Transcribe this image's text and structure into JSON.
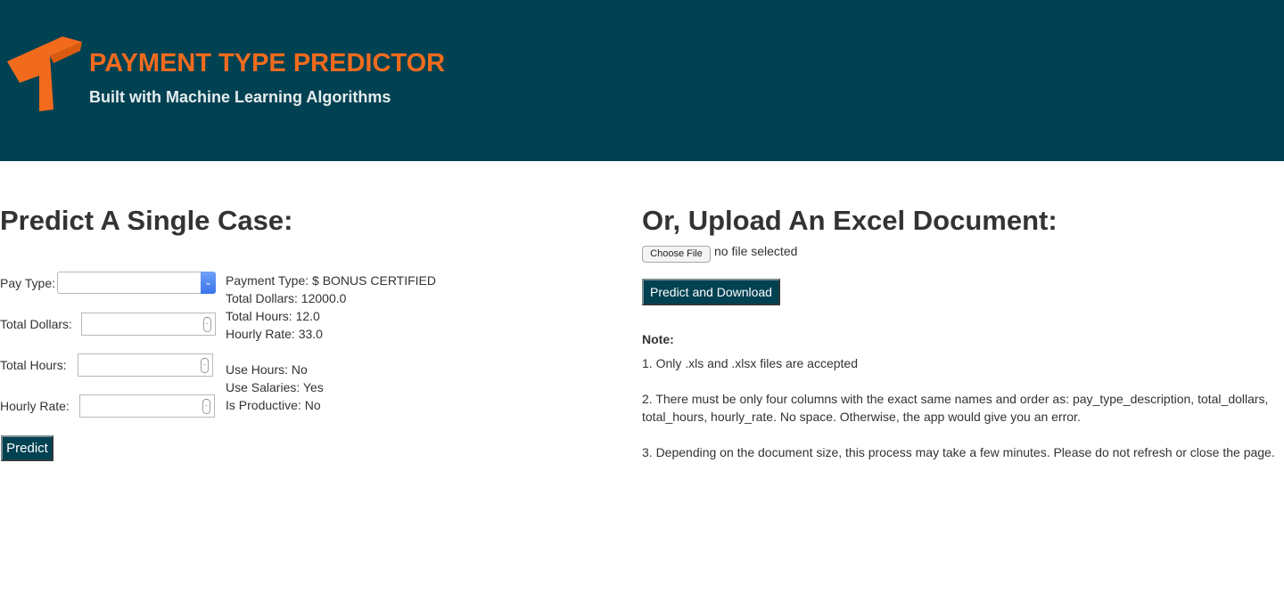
{
  "header": {
    "title": "PAYMENT TYPE PREDICTOR",
    "subtitle": "Built with Machine Learning Algorithms",
    "logo_icon": "orange-t-logo-icon",
    "background_color": "#004152",
    "accent_color": "#f26b1d"
  },
  "single_case": {
    "title": "Predict A Single Case:",
    "fields": {
      "pay_type_label": "Pay Type:",
      "pay_type_value": "",
      "total_dollars_label": "Total Dollars:",
      "total_dollars_value": "",
      "total_hours_label": "Total Hours:",
      "total_hours_value": "",
      "hourly_rate_label": "Hourly Rate:",
      "hourly_rate_value": ""
    },
    "result": {
      "payment_type": "Payment Type: $ BONUS CERTIFIED",
      "total_dollars": "Total Dollars: 12000.0",
      "total_hours": "Total Hours: 12.0",
      "hourly_rate": "Hourly Rate: 33.0",
      "use_hours": "Use Hours: No",
      "use_salaries": "Use Salaries: Yes",
      "is_productive": "Is Productive: No"
    },
    "predict_label": "Predict"
  },
  "upload": {
    "title": "Or, Upload An Excel Document:",
    "choose_file_label": "Choose File",
    "file_status": "no file selected",
    "download_label": "Predict and Download",
    "note_heading": "Note:",
    "notes": {
      "n1": "1. Only .xls and .xlsx files are accepted",
      "n2a": "2. There must be only four columns with the exact same names and order as: pay_type_description, total_dollars,",
      "n2b": "total_hours, hourly_rate. No space. Otherwise, the app would give you an error.",
      "n3": "3. Depending on the document size, this process may take a few minutes. Please do not refresh or close the page."
    }
  }
}
